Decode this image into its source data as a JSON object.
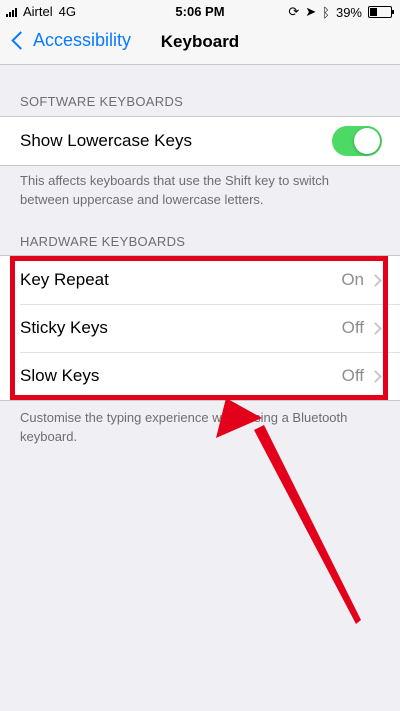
{
  "status_bar": {
    "carrier": "Airtel",
    "network": "4G",
    "time": "5:06 PM",
    "battery_percent": "39%",
    "battery_level": 0.39
  },
  "nav": {
    "back_label": "Accessibility",
    "title": "Keyboard"
  },
  "software_section": {
    "header": "SOFTWARE KEYBOARDS",
    "items": [
      {
        "label": "Show Lowercase Keys",
        "toggle_on": true
      }
    ],
    "footer": "This affects keyboards that use the Shift key to switch between uppercase and lowercase letters."
  },
  "hardware_section": {
    "header": "HARDWARE KEYBOARDS",
    "items": [
      {
        "label": "Key Repeat",
        "value": "On"
      },
      {
        "label": "Sticky Keys",
        "value": "Off"
      },
      {
        "label": "Slow Keys",
        "value": "Off"
      }
    ],
    "footer": "Customise the typing experience when using a Bluetooth keyboard."
  },
  "colors": {
    "accent": "#0a7bff",
    "toggle_on": "#4cd964",
    "annotation": "#e3001b"
  }
}
